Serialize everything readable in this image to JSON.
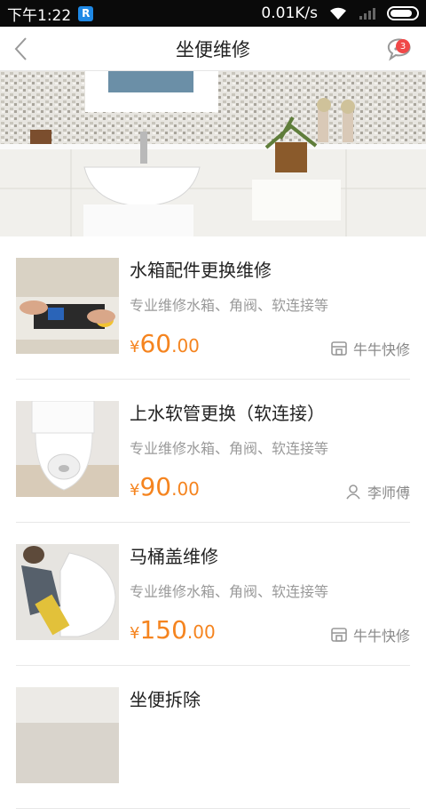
{
  "status_bar": {
    "time": "下午1:22",
    "network_speed": "0.01K/s"
  },
  "nav": {
    "title": "坐便维修",
    "message_badge": "3"
  },
  "services": [
    {
      "title": "水箱配件更换维修",
      "desc": "专业维修水箱、角阀、软连接等",
      "currency": "¥",
      "price_int": "60",
      "price_dec": ".00",
      "vendor": "牛牛快修",
      "vendor_icon": "shop-icon"
    },
    {
      "title": "上水软管更换（软连接）",
      "desc": "专业维修水箱、角阀、软连接等",
      "currency": "¥",
      "price_int": "90",
      "price_dec": ".00",
      "vendor": "李师傅",
      "vendor_icon": "person-icon"
    },
    {
      "title": "马桶盖维修",
      "desc": "专业维修水箱、角阀、软连接等",
      "currency": "¥",
      "price_int": "150",
      "price_dec": ".00",
      "vendor": "牛牛快修",
      "vendor_icon": "shop-icon"
    },
    {
      "title": "坐便拆除"
    }
  ],
  "colors": {
    "accent_price": "#f5841f",
    "badge": "#f04848",
    "status_bar_bg": "#0a0a0a"
  }
}
